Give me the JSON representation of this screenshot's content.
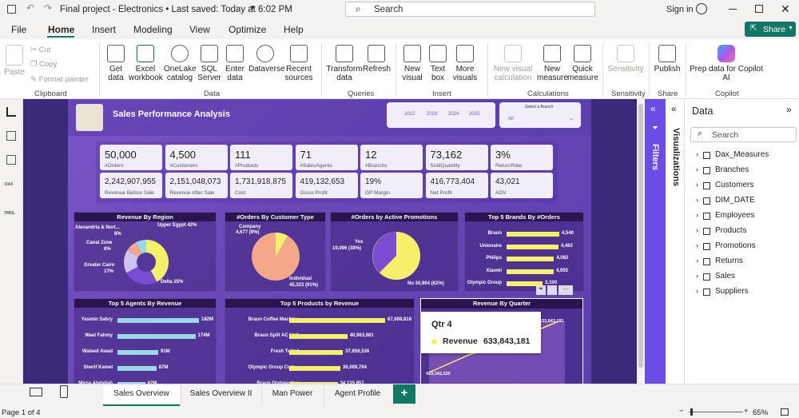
{
  "title": "Final project - Electronics • Last saved: Today at 6:02 PM",
  "search": "Search",
  "signin": "Sign in",
  "menu": [
    "File",
    "Home",
    "Insert",
    "Modeling",
    "View",
    "Optimize",
    "Help"
  ],
  "share": "Share",
  "ribbon": {
    "paste": "Paste",
    "cut": "Cut",
    "copy": "Copy",
    "format_painter": "Format painter",
    "get_data": "Get data",
    "excel": "Excel workbook",
    "onelake": "OneLake catalog",
    "sql": "SQL Server",
    "enter_data": "Enter data",
    "dataverse": "Dataverse",
    "recent": "Recent sources",
    "transform": "Transform data",
    "refresh": "Refresh",
    "new_visual": "New visual",
    "text_box": "Text box",
    "more_visuals": "More visuals",
    "new_visual_calc": "New visual calculation",
    "new_measure": "New measure",
    "quick_measure": "Quick measure",
    "sensitivity": "Sensitivity",
    "publish": "Publish",
    "copilot": "Prep data for Copilot AI",
    "groups": [
      "Clipboard",
      "Data",
      "Queries",
      "Insert",
      "Calculations",
      "Sensitivity",
      "Share",
      "Copilot"
    ]
  },
  "report": {
    "title": "Sales Performance Analysis",
    "years": [
      "2022",
      "2023",
      "2024",
      "2025"
    ],
    "branch_label": "Select a Branch",
    "branch_value": "All",
    "kpis": [
      {
        "v": "50,000",
        "l": "#Orders",
        "v2": "2,242,907,955",
        "l2": "Revenue Before Sale"
      },
      {
        "v": "4,500",
        "l": "#Customers",
        "v2": "2,151,048,073",
        "l2": "Revenue After Sale"
      },
      {
        "v": "111",
        "l": "#Products",
        "v2": "1,731,918,875",
        "l2": "Cost"
      },
      {
        "v": "71",
        "l": "#SalesAgents",
        "v2": "419,132,653",
        "l2": "Gross Profit"
      },
      {
        "v": "12",
        "l": "#Branchs",
        "v2": "19%",
        "l2": "GP Margin"
      },
      {
        "v": "73,162",
        "l": "SoldQuantity",
        "v2": "416,773,404",
        "l2": "Net Profit"
      },
      {
        "v": "3%",
        "l": "ReturnRate",
        "v2": "43,021",
        "l2": "AOV"
      }
    ],
    "region": {
      "title": "Revenue By Region",
      "labels": [
        "Alexandria & Nort...",
        "8%",
        "Upper Egypt 42%",
        "Canal Zone",
        "8%",
        "Greater Cairo",
        "17%",
        "Delta 25%"
      ]
    },
    "custtype": {
      "title": "#Orders By Customer Type",
      "labels": [
        "Company",
        "4,677 (9%)",
        "Individual",
        "45,323 (91%)"
      ]
    },
    "promo": {
      "title": "#Orders by Active Promotions",
      "labels": [
        "Yes",
        "19,096 (38%)",
        "No 30,904 (62%)"
      ]
    },
    "brands": {
      "title": "Top 5 Brands By #Orders",
      "items": [
        [
          "Braun",
          "4,540"
        ],
        [
          "Unionaire",
          "4,462"
        ],
        [
          "Philips",
          "4,082"
        ],
        [
          "Xiaomi",
          "4,055"
        ],
        [
          "Olympic Group",
          "3,100"
        ]
      ]
    },
    "agents": {
      "title": "Top 5 Agents By Revenue",
      "items": [
        [
          "Yasmin Sabry",
          "182M"
        ],
        [
          "Wael Fahmy",
          "174M"
        ],
        [
          "Waleed Awad",
          "91M"
        ],
        [
          "Sherif Kamel",
          "87M"
        ],
        [
          "Mirna Abdallah",
          "62M"
        ]
      ]
    },
    "products": {
      "title": "Top 5 Products by Revenue",
      "items": [
        [
          "Braun Coffee Machine",
          "67,608,816"
        ],
        [
          "Braun Split AC Unit",
          "40,963,681"
        ],
        [
          "Fresh Tablet",
          "37,856,536"
        ],
        [
          "Olympic Group Com...",
          "36,009,764"
        ],
        [
          "Braun Dishwasher",
          "34,135,957"
        ]
      ]
    },
    "quarter": {
      "title": "Revenue By Quarter",
      "tip_title": "Qtr 4",
      "tip_label": "Revenue",
      "tip_value": "633,843,181",
      "point_label": "633,843,181",
      "start_label": "433,342,320"
    }
  },
  "filters_label": "Filters",
  "vis_label": "Visualizations",
  "data_pane": {
    "title": "Data",
    "search": "Search",
    "items": [
      "Dax_Measures",
      "Branches",
      "Customers",
      "DIM_DATE",
      "Employees",
      "Products",
      "Promotions",
      "Returns",
      "Sales",
      "Suppliers"
    ]
  },
  "tabs": [
    "Sales Overview",
    "Sales Overview II",
    "Man Power",
    "Agent Profile"
  ],
  "status": {
    "page": "Page 1 of 4",
    "zoom": "65%"
  },
  "colors": {
    "accent": "#6b4ce6",
    "bar": "#f5f06a",
    "bar2": "#9ad8e6",
    "pie1": "#f5a78a",
    "pie2": "#f5f06a",
    "pie3": "#7a4cd0"
  }
}
